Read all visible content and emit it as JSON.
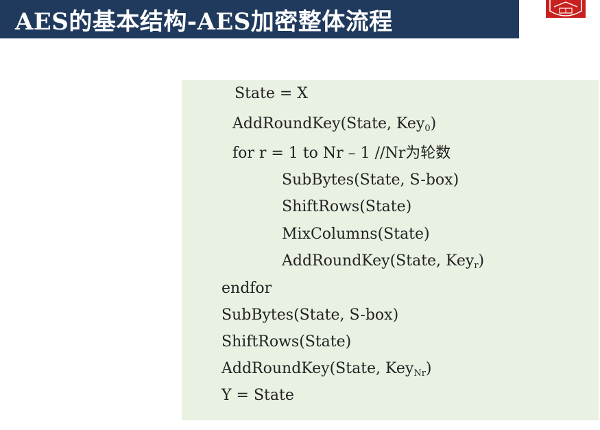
{
  "header": {
    "title": "AES的基本结构-AES加密整体流程"
  },
  "logo": {
    "icon": "university-seal-icon",
    "color": "#c8201e"
  },
  "code": {
    "lines": [
      {
        "text": "State = X"
      },
      {
        "text": "AddRoundKey(State, Key",
        "sub": "0",
        "after": ")"
      },
      {
        "text": "for r = 1 to Nr – 1 //Nr为轮数"
      },
      {
        "text": "SubBytes(State, S-box)"
      },
      {
        "text": "ShiftRows(State)"
      },
      {
        "text": "MixColumns(State)"
      },
      {
        "text": "AddRoundKey(State, Key",
        "sub": "r",
        "after": ")"
      },
      {
        "text": "endfor"
      },
      {
        "text": "SubBytes(State, S-box)"
      },
      {
        "text": "ShiftRows(State)"
      },
      {
        "text": "AddRoundKey(State, Key",
        "sub": "Nr",
        "after": ")"
      },
      {
        "text": "Y = State"
      }
    ]
  },
  "colors": {
    "title_bar": "#1f3a5c",
    "code_background": "#e9f1e3"
  }
}
